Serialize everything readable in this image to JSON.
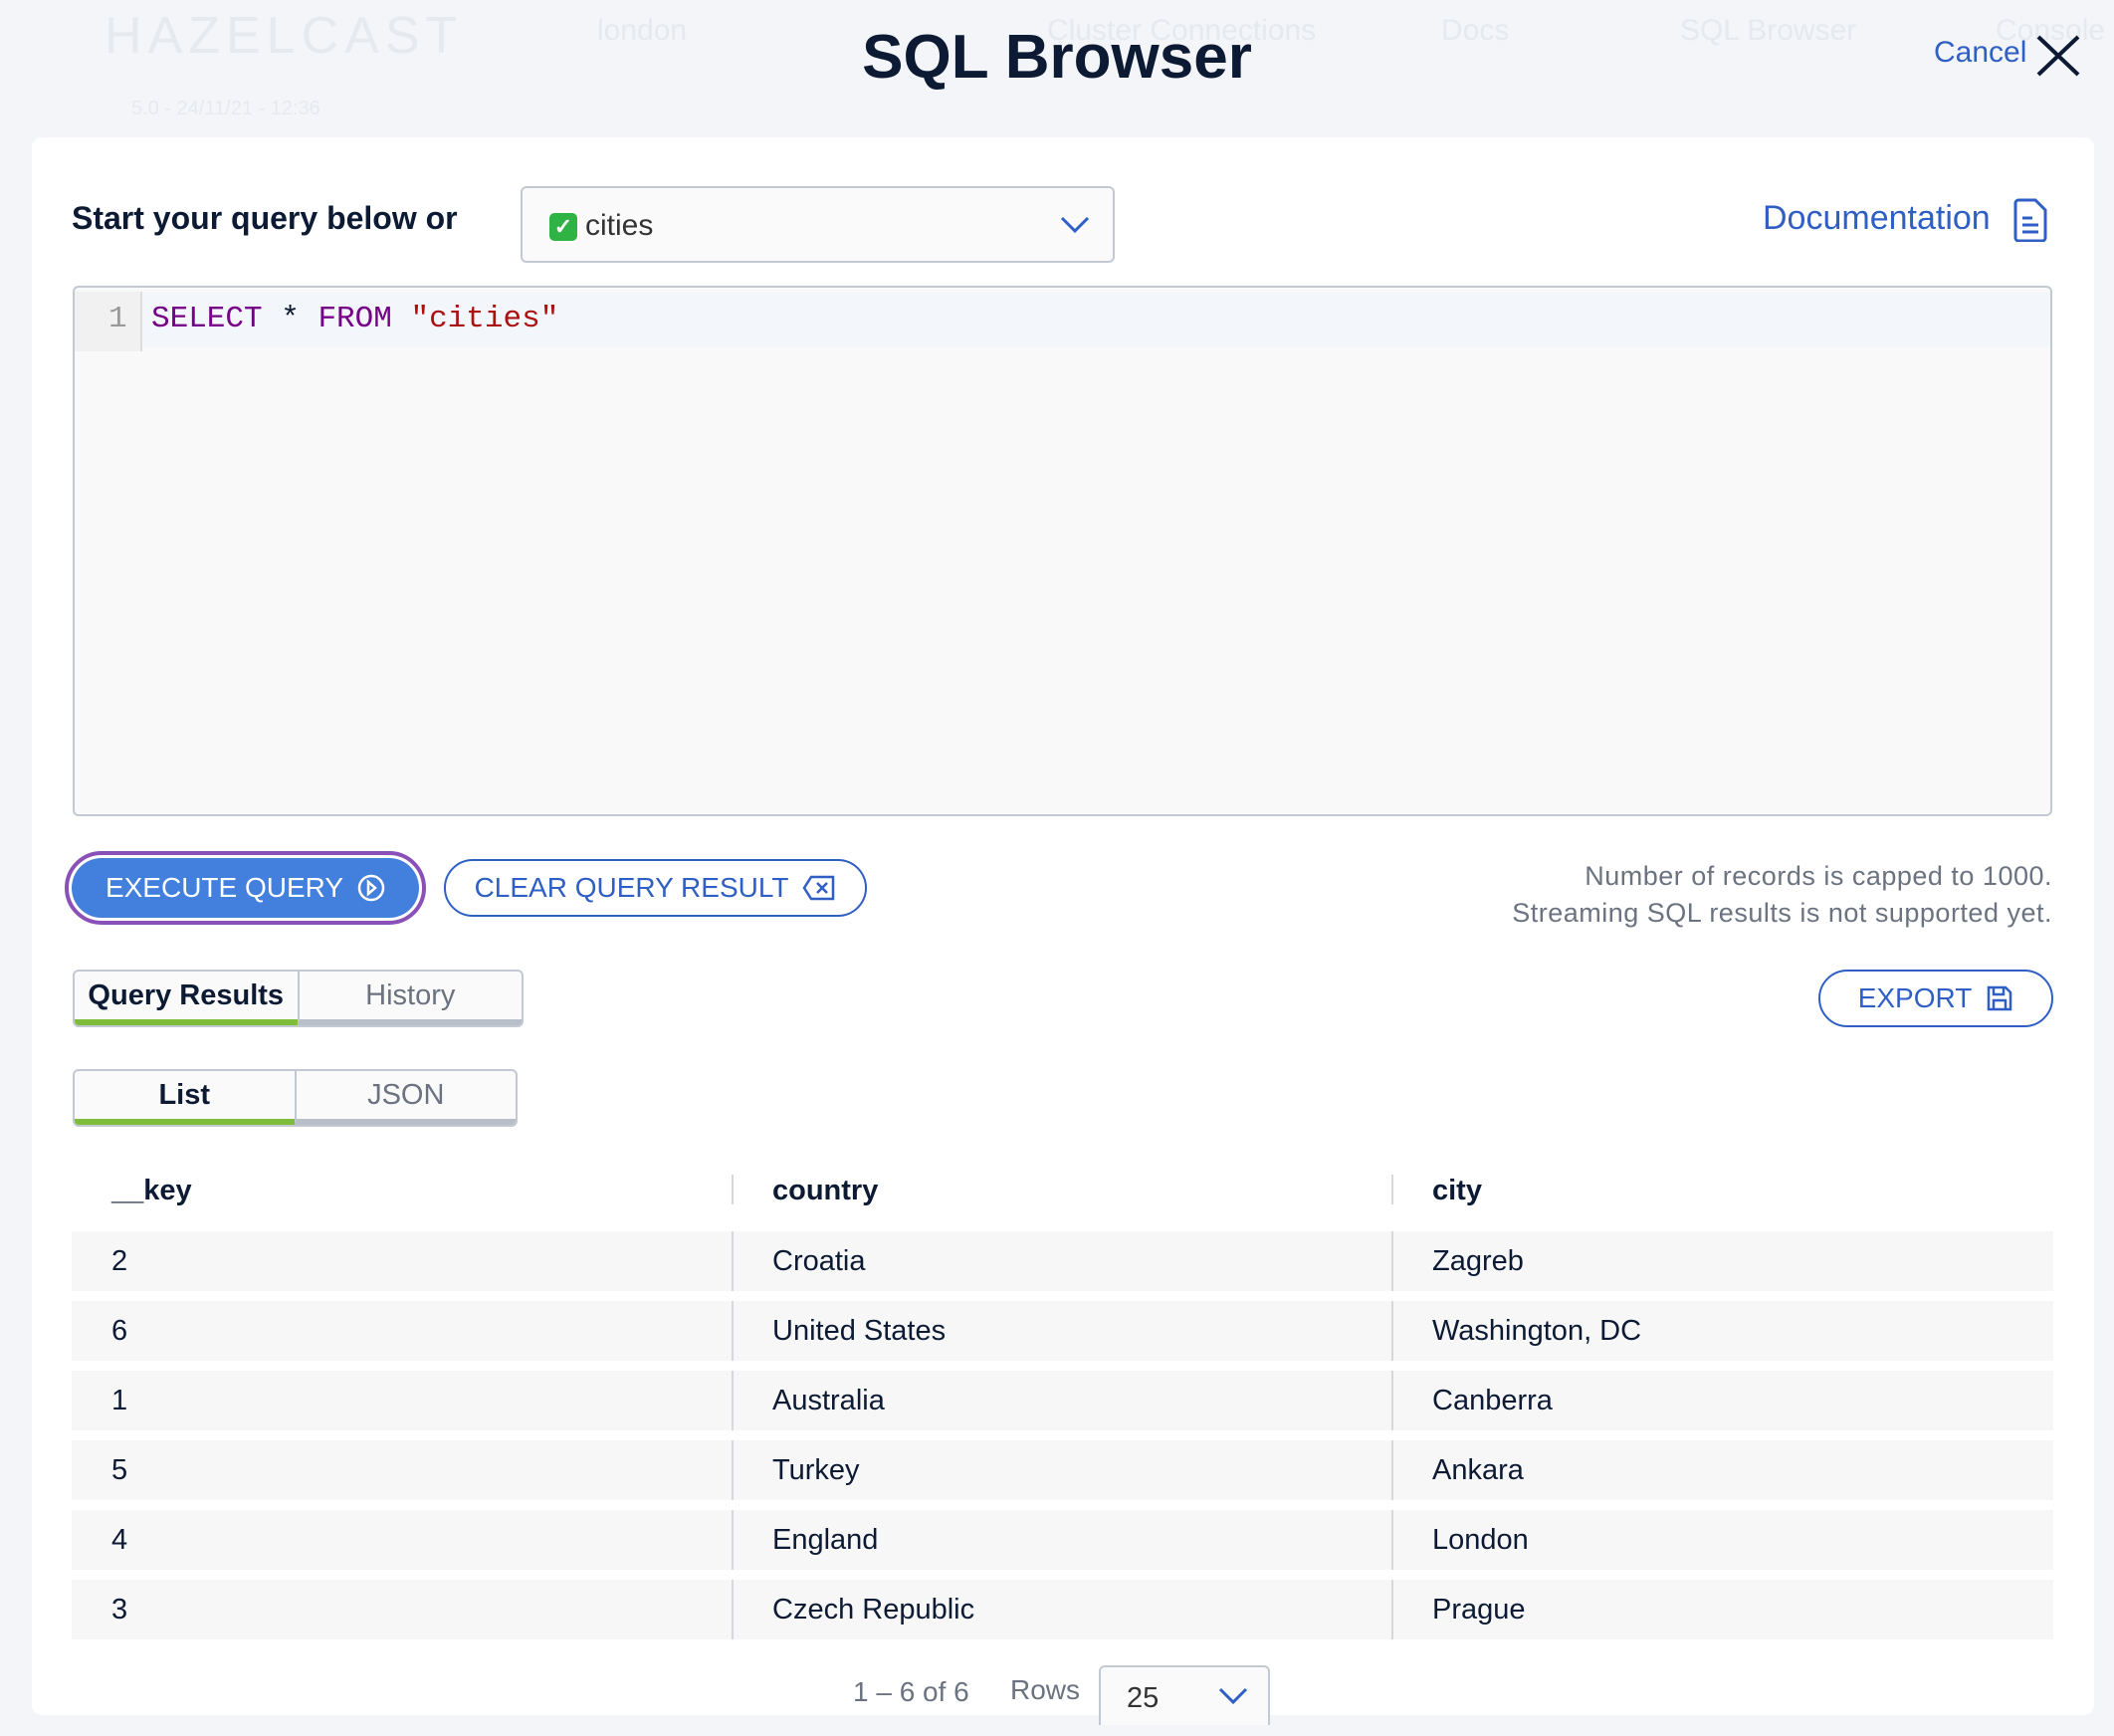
{
  "background": {
    "logo": "HAZELCAST",
    "cluster": "london",
    "nav": [
      "Cluster Connections",
      "Docs",
      "SQL Browser",
      "Console"
    ],
    "version": "5.0 - 24/11/21 - 12:36"
  },
  "header": {
    "title": "SQL Browser",
    "cancel": "Cancel"
  },
  "query": {
    "label": "Start your query below or",
    "map_select": "cities",
    "map_status_icon": "check-box-icon",
    "documentation": "Documentation"
  },
  "editor": {
    "line_number": "1",
    "tokens": [
      {
        "text": "SELECT",
        "type": "keyword"
      },
      {
        "text": " * ",
        "type": "op"
      },
      {
        "text": "FROM",
        "type": "keyword"
      },
      {
        "text": " ",
        "type": "op"
      },
      {
        "text": "\"cities\"",
        "type": "string"
      }
    ]
  },
  "actions": {
    "execute": "EXECUTE QUERY",
    "clear": "CLEAR QUERY RESULT",
    "notice_1": "Number of records is capped to 1000.",
    "notice_2": "Streaming SQL results is not supported yet.",
    "export": "EXPORT"
  },
  "tabs": [
    {
      "label": "Query Results",
      "active": true
    },
    {
      "label": "History",
      "active": false
    }
  ],
  "view_tabs": [
    {
      "label": "List",
      "active": true
    },
    {
      "label": "JSON",
      "active": false
    }
  ],
  "table": {
    "columns": [
      "__key",
      "country",
      "city"
    ],
    "rows": [
      [
        "2",
        "Croatia",
        "Zagreb"
      ],
      [
        "6",
        "United States",
        "Washington, DC"
      ],
      [
        "1",
        "Australia",
        "Canberra"
      ],
      [
        "5",
        "Turkey",
        "Ankara"
      ],
      [
        "4",
        "England",
        "London"
      ],
      [
        "3",
        "Czech Republic",
        "Prague"
      ]
    ]
  },
  "pagination": {
    "range": "1 – 6 of 6",
    "rows_label": "Rows",
    "rows_value": "25"
  },
  "colors": {
    "accent": "#2f5fc4",
    "execute_fill": "#437fdc",
    "focus_ring": "#8b4fb8",
    "tab_active": "#7dbd3a",
    "keyword": "#770088",
    "string": "#aa1111"
  }
}
